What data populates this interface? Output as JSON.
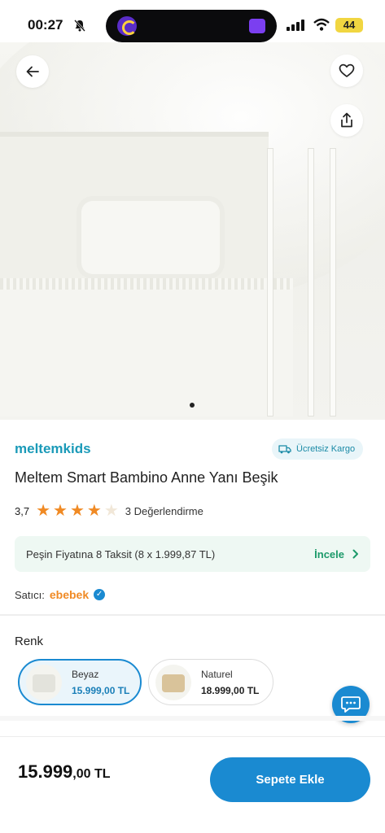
{
  "status_bar": {
    "time": "00:27",
    "battery": "44"
  },
  "product": {
    "brand": "meltemkids",
    "free_shipping": "Ücretsiz Kargo",
    "title": "Meltem Smart Bambino Anne Yanı Beşik",
    "rating": "3,7",
    "rating_stars_filled": 3.7,
    "rating_stars_total": 5,
    "review_count": "3 Değerlendirme"
  },
  "installment": {
    "text": "Peşin Fiyatına 8 Taksit (8 x 1.999,87 TL)",
    "link": "İncele"
  },
  "seller": {
    "label": "Satıcı:",
    "name": "ebebek"
  },
  "variants": {
    "label": "Renk",
    "items": [
      {
        "name": "Beyaz",
        "price": "15.999,00 TL",
        "selected": true
      },
      {
        "name": "Naturel",
        "price": "18.999,00 TL",
        "selected": false
      }
    ]
  },
  "footer": {
    "price_int": "15.999",
    "price_dec": ",00 TL",
    "cart_button": "Sepete Ekle"
  },
  "gallery": {
    "current_image": 1
  },
  "colors": {
    "accent": "#1a8ad1",
    "brand": "#1a9ab8",
    "star": "#f08a24",
    "success": "#1c9a6a"
  },
  "icons": [
    "back-arrow-icon",
    "heart-icon",
    "share-icon",
    "truck-icon",
    "chevron-right-icon",
    "verified-icon",
    "chat-icon"
  ]
}
